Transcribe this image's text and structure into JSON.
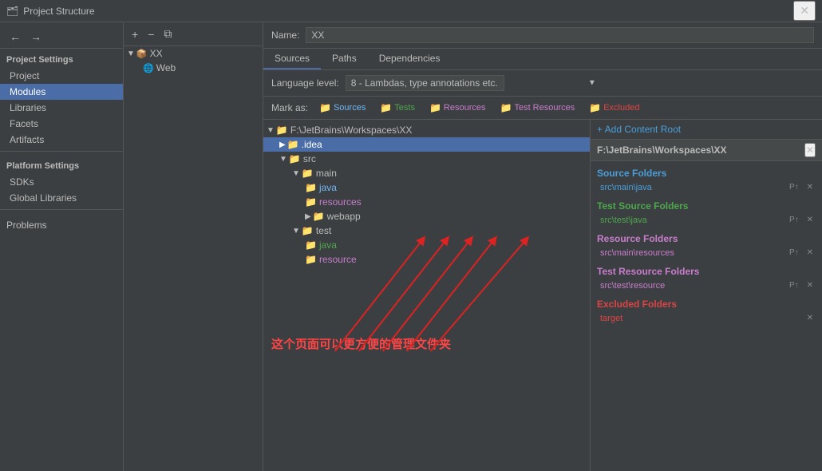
{
  "titlebar": {
    "icon": "🗂",
    "title": "Project Structure",
    "close_label": "✕"
  },
  "sidebar": {
    "nav_back": "←",
    "nav_forward": "→",
    "project_settings_label": "Project Settings",
    "items": [
      {
        "id": "project",
        "label": "Project"
      },
      {
        "id": "modules",
        "label": "Modules",
        "active": true
      },
      {
        "id": "libraries",
        "label": "Libraries"
      },
      {
        "id": "facets",
        "label": "Facets"
      },
      {
        "id": "artifacts",
        "label": "Artifacts"
      }
    ],
    "platform_settings_label": "Platform Settings",
    "platform_items": [
      {
        "id": "sdks",
        "label": "SDKs"
      },
      {
        "id": "global-libraries",
        "label": "Global Libraries"
      }
    ],
    "problems_label": "Problems"
  },
  "tree_panel": {
    "add_label": "+",
    "remove_label": "−",
    "copy_label": "⧉",
    "module_name": "XX",
    "module_sub": "Web"
  },
  "content": {
    "name_label": "Name:",
    "name_value": "XX",
    "tabs": [
      "Sources",
      "Paths",
      "Dependencies"
    ],
    "active_tab": "Sources",
    "lang_label": "Language level:",
    "lang_value": "8 - Lambdas, type annotations etc.",
    "mark_label": "Mark as:",
    "mark_buttons": [
      {
        "id": "sources",
        "icon": "📁",
        "label": "Sources",
        "color": "#6eb7f5"
      },
      {
        "id": "tests",
        "icon": "📁",
        "label": "Tests",
        "color": "#4ea64e"
      },
      {
        "id": "resources",
        "icon": "📁",
        "label": "Resources",
        "color": "#c77dcc"
      },
      {
        "id": "test-resources",
        "icon": "📁",
        "label": "Test Resources",
        "color": "#c77dcc"
      },
      {
        "id": "excluded",
        "icon": "📁",
        "label": "Excluded",
        "color": "#d44"
      }
    ]
  },
  "file_tree": {
    "root": {
      "label": "F:\\JetBrains\\Workspaces\\XX",
      "expanded": true,
      "children": [
        {
          "label": ".idea",
          "selected": true,
          "expanded": false,
          "children": []
        },
        {
          "label": "src",
          "expanded": true,
          "children": [
            {
              "label": "main",
              "expanded": true,
              "children": [
                {
                  "label": "java",
                  "type": "source",
                  "children": []
                },
                {
                  "label": "resources",
                  "type": "resources",
                  "children": []
                },
                {
                  "label": "webapp",
                  "expanded": false,
                  "children": []
                }
              ]
            },
            {
              "label": "test",
              "expanded": true,
              "children": [
                {
                  "label": "java",
                  "type": "test",
                  "children": []
                },
                {
                  "label": "resource",
                  "type": "test-resources",
                  "children": []
                }
              ]
            }
          ]
        }
      ]
    }
  },
  "right_panel": {
    "add_btn": "+ Add Content Root",
    "path_header": "F:\\JetBrains\\Workspaces\\XX",
    "close_btn": "✕",
    "sections": [
      {
        "id": "source-folders",
        "title": "Source Folders",
        "color_class": "sources",
        "items": [
          {
            "path": "src\\main\\java",
            "actions": [
              "P↑",
              "✕"
            ]
          }
        ]
      },
      {
        "id": "test-source-folders",
        "title": "Test Source Folders",
        "color_class": "tests",
        "items": [
          {
            "path": "src\\test\\java",
            "actions": [
              "P↑",
              "✕"
            ]
          }
        ]
      },
      {
        "id": "resource-folders",
        "title": "Resource Folders",
        "color_class": "resources",
        "items": [
          {
            "path": "src\\main\\resources",
            "actions": [
              "P↑",
              "✕"
            ]
          }
        ]
      },
      {
        "id": "test-resource-folders",
        "title": "Test Resource Folders",
        "color_class": "test-resources",
        "items": [
          {
            "path": "src\\test\\resource",
            "actions": [
              "P↑",
              "✕"
            ]
          }
        ]
      },
      {
        "id": "excluded-folders",
        "title": "Excluded Folders",
        "color_class": "excluded",
        "items": [
          {
            "path": "target",
            "actions": [
              "✕"
            ]
          }
        ]
      }
    ]
  },
  "annotation": {
    "text": "这个页面可以更方便的管理文件夹"
  }
}
